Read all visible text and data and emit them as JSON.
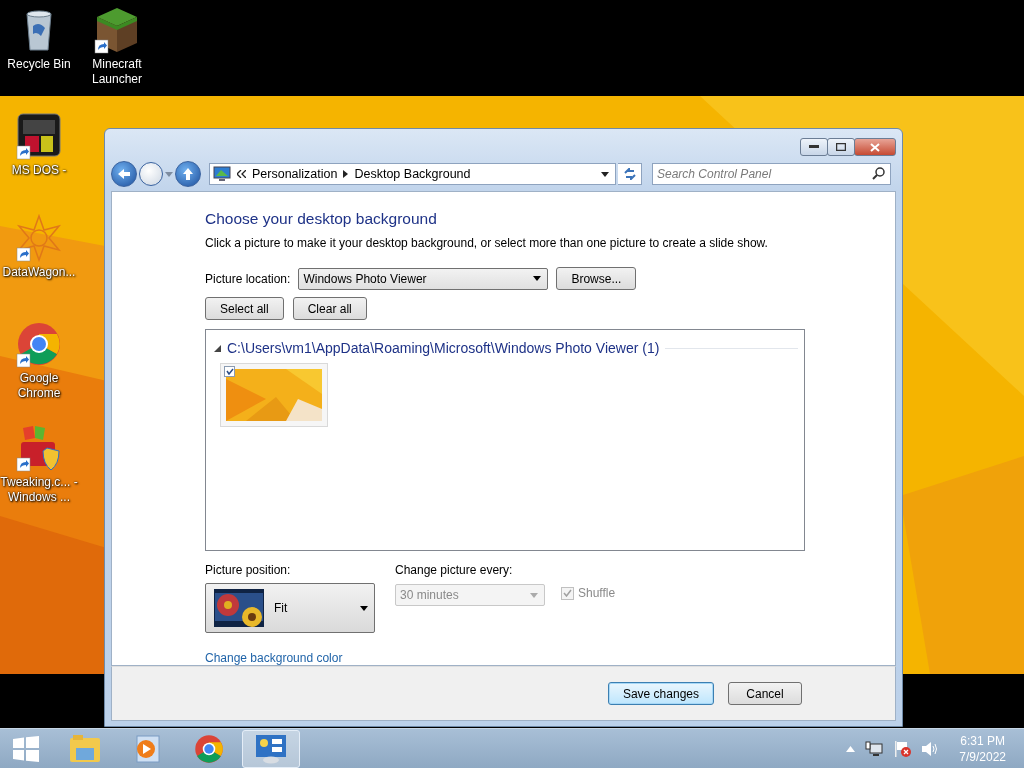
{
  "desktop_icons": [
    {
      "label": "Recycle Bin",
      "kind": "recycle",
      "shortcut": false
    },
    {
      "label": "Minecraft Launcher",
      "kind": "block",
      "shortcut": true
    },
    {
      "label": "MS DOS -",
      "kind": "dos",
      "shortcut": true
    },
    {
      "label": "DataWagon...",
      "kind": "star",
      "shortcut": true
    },
    {
      "label": "Google Chrome",
      "kind": "chrome",
      "shortcut": true
    },
    {
      "label": "Tweaking.c... - Windows ...",
      "kind": "toolbox",
      "shortcut": true
    }
  ],
  "window": {
    "address": {
      "crumbs": [
        "Personalization",
        "Desktop Background"
      ]
    },
    "search": {
      "placeholder": "Search Control Panel"
    },
    "heading": "Choose your desktop background",
    "description": "Click a picture to make it your desktop background, or select more than one picture to create a slide show.",
    "picture_location": {
      "label": "Picture location:",
      "value": "Windows Photo Viewer"
    },
    "browse_button": "Browse...",
    "select_all_button": "Select all",
    "clear_all_button": "Clear all",
    "group": {
      "path": "C:\\Users\\vm1\\AppData\\Roaming\\Microsoft\\Windows Photo Viewer (1)",
      "expanded": true,
      "pictures": [
        {
          "kind": "picture",
          "checked": true
        }
      ]
    },
    "picture_position": {
      "label": "Picture position:",
      "value": "Fit"
    },
    "change_picture": {
      "label": "Change picture every:",
      "value": "30 minutes",
      "disabled": true
    },
    "shuffle": {
      "label": "Shuffle",
      "checked": true,
      "disabled": true
    },
    "link": "Change background color",
    "buttons": [
      {
        "label": "Save changes",
        "default": true
      },
      {
        "label": "Cancel",
        "default": false
      }
    ]
  },
  "taskbar": {
    "items": [
      {
        "kind": "explorer",
        "selected": false
      },
      {
        "kind": "media",
        "selected": false
      },
      {
        "kind": "chrome",
        "selected": false
      },
      {
        "kind": "control",
        "selected": true
      }
    ],
    "clock": {
      "time": "6:31 PM",
      "date": "7/9/2022"
    }
  }
}
